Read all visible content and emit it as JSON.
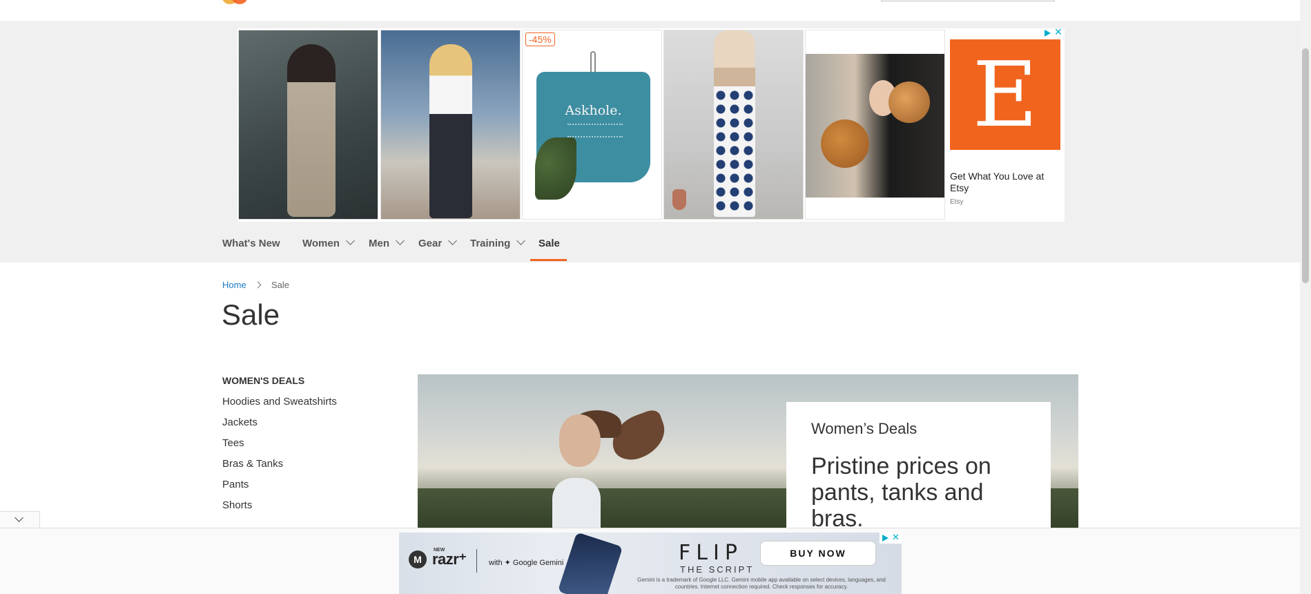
{
  "header": {
    "logo": "luma-logo",
    "search_icon": "search-icon"
  },
  "ad_banner": {
    "discount_badge": "-45%",
    "shirt_text": "Askhole.",
    "etsy_logo_letter": "E",
    "etsy_headline": "Get What You Love at Etsy",
    "etsy_brand": "Etsy",
    "adchoices_icon": "adchoices-icon",
    "close_icon": "close-icon"
  },
  "nav": {
    "items": [
      {
        "label": "What's New",
        "has_dropdown": false
      },
      {
        "label": "Women",
        "has_dropdown": true
      },
      {
        "label": "Men",
        "has_dropdown": true
      },
      {
        "label": "Gear",
        "has_dropdown": true
      },
      {
        "label": "Training",
        "has_dropdown": true
      },
      {
        "label": "Sale",
        "has_dropdown": false,
        "active": true
      }
    ],
    "active_color": "#f26322"
  },
  "breadcrumb": {
    "home": "Home",
    "current": "Sale"
  },
  "page": {
    "title": "Sale"
  },
  "sidebar": {
    "heading": "WOMEN'S DEALS",
    "links": [
      "Hoodies and Sweatshirts",
      "Jackets",
      "Tees",
      "Bras & Tanks",
      "Pants",
      "Shorts"
    ]
  },
  "hero": {
    "kicker": "Women’s Deals",
    "headline": "Pristine prices on pants, tanks and bras."
  },
  "bottom_ad": {
    "brand_new": "NEW",
    "brand": "razr⁺",
    "gemini": "with ✦ Google Gemini",
    "flip": "FLIP",
    "script": "THE SCRIPT",
    "button": "BUY NOW",
    "fine_print": "Gemini is a trademark of Google LLC. Gemini mobile app available on select devices, languages, and countries. Internet connection required. Check responses for accuracy."
  },
  "colors": {
    "brand_orange": "#f26322",
    "link_blue": "#1979c3",
    "etsy_orange": "#f1641e"
  }
}
